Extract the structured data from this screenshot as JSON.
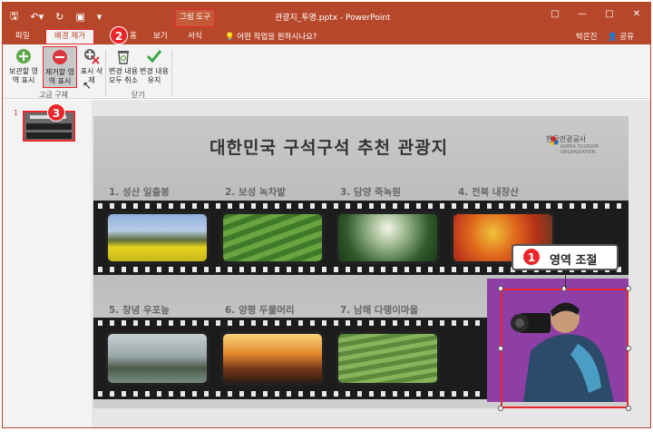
{
  "window": {
    "title": "관광지_투명.pptx - PowerPoint",
    "context_tool": "그림 도구",
    "user": "박은진",
    "share": "공유"
  },
  "tabs": {
    "file": "파일",
    "remove_bg": "배경 제거",
    "home": "홈",
    "view": "보기",
    "format": "서식",
    "tell_me": "어떤 작업을 원하시나요?"
  },
  "ribbon": {
    "mark_keep": "보관할 영역 표시",
    "mark_remove": "제거할 영역 표시",
    "delete_mark": "표시 삭제",
    "discard_all": "변경 내용 모두 취소",
    "keep_changes": "변경 내용 유지",
    "group_refine": "고급 구체",
    "group_close": "닫기"
  },
  "thumbnails": {
    "current_number": "1"
  },
  "slide": {
    "title": "대한민국 구석구석 추천 관광지",
    "brand": "한국관광공사",
    "brand_sub": "KOREA TOURISM ORGANIZATION",
    "captions": [
      "1. 성산 일출봉",
      "2. 보성 녹차밭",
      "3. 담양 죽녹원",
      "4. 전북 내장산",
      "5. 창녕 우포늪",
      "6. 양평 두물머리",
      "7. 남해 다랭이마을"
    ]
  },
  "steps": {
    "s1": "1",
    "s2": "2",
    "s3": "3"
  },
  "callout": {
    "label": "영역 조절"
  },
  "colors": {
    "accent": "#b7472a",
    "highlight": "#e8262b",
    "removal_overlay": "#8e3fa6"
  }
}
